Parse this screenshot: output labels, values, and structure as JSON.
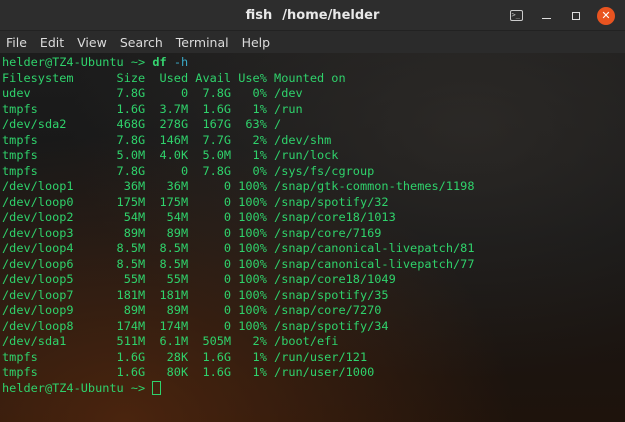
{
  "window": {
    "title_app": "fish",
    "title_path": "/home/helder"
  },
  "menu": [
    "File",
    "Edit",
    "View",
    "Search",
    "Terminal",
    "Help"
  ],
  "icons": {
    "terminal": "terminal-icon",
    "minimize": "minimize-icon",
    "maximize": "maximize-icon",
    "close": "close-icon"
  },
  "colors": {
    "text": "#2fd26b",
    "close": "#e95420",
    "flag": "#3aaac7"
  },
  "terminal": {
    "prompt": "helder@TZ4-Ubuntu ~> ",
    "command": "df",
    "flag": "-h",
    "header": "Filesystem      Size  Used Avail Use% Mounted on",
    "rows": [
      "udev            7.8G     0  7.8G   0% /dev",
      "tmpfs           1.6G  3.7M  1.6G   1% /run",
      "/dev/sda2       468G  278G  167G  63% /",
      "tmpfs           7.8G  146M  7.7G   2% /dev/shm",
      "tmpfs           5.0M  4.0K  5.0M   1% /run/lock",
      "tmpfs           7.8G     0  7.8G   0% /sys/fs/cgroup",
      "/dev/loop1       36M   36M     0 100% /snap/gtk-common-themes/1198",
      "/dev/loop0      175M  175M     0 100% /snap/spotify/32",
      "/dev/loop2       54M   54M     0 100% /snap/core18/1013",
      "/dev/loop3       89M   89M     0 100% /snap/core/7169",
      "/dev/loop4      8.5M  8.5M     0 100% /snap/canonical-livepatch/81",
      "/dev/loop6      8.5M  8.5M     0 100% /snap/canonical-livepatch/77",
      "/dev/loop5       55M   55M     0 100% /snap/core18/1049",
      "/dev/loop7      181M  181M     0 100% /snap/spotify/35",
      "/dev/loop9       89M   89M     0 100% /snap/core/7270",
      "/dev/loop8      174M  174M     0 100% /snap/spotify/34",
      "/dev/sda1       511M  6.1M  505M   2% /boot/efi",
      "tmpfs           1.6G   28K  1.6G   1% /run/user/121",
      "tmpfs           1.6G   80K  1.6G   1% /run/user/1000"
    ]
  }
}
